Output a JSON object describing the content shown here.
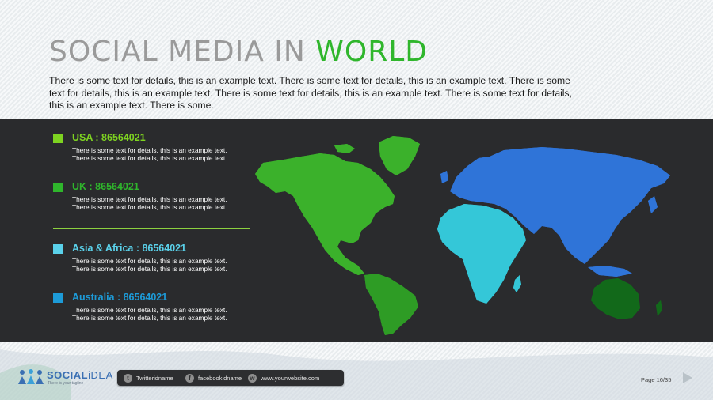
{
  "title": {
    "part1": "SOCIAL MEDIA IN ",
    "part2": "WORLD"
  },
  "intro": "There is some text for details, this is an example text. There is some text for details, this is an example text. There is some text for details, this is an example text. There is some text for details, this is an example text. There is some text for details, this is an example text. There is some.",
  "stats": [
    {
      "label": "USA : 86564021",
      "color": "#7ed321",
      "desc": "There is some text for details, this is an example text. There is some text for details, this is an example text."
    },
    {
      "label": "UK : 86564021",
      "color": "#2fb62c",
      "desc": "There is some text for details, this is an example text. There is some text for details, this is an example text."
    },
    {
      "label": "Asia & Africa : 86564021",
      "color": "#5ad1ea",
      "desc": "There is some text for details, this is an example text. There is some text for details, this is an example text."
    },
    {
      "label": "Australia : 86564021",
      "color": "#1d9bd8",
      "desc": "There is some text for details, this is an example text. There is some text for details, this is an example text."
    }
  ],
  "map_colors": {
    "north_america": "#3bb12b",
    "south_america": "#2e9c25",
    "africa": "#34c7d8",
    "eurasia": "#2f74d8",
    "australia": "#12691a"
  },
  "brand": {
    "name_part1": "SOCIAL",
    "name_part2": "iDEA",
    "tagline": "There is your tagline"
  },
  "social": [
    {
      "icon": "twitter-icon",
      "glyph": "t",
      "label": "Twitteridname"
    },
    {
      "icon": "facebook-icon",
      "glyph": "f",
      "label": "facebookidname"
    },
    {
      "icon": "web-icon",
      "glyph": "w",
      "label": "www.yourwebsite.com"
    }
  ],
  "page": "Page 16/35"
}
